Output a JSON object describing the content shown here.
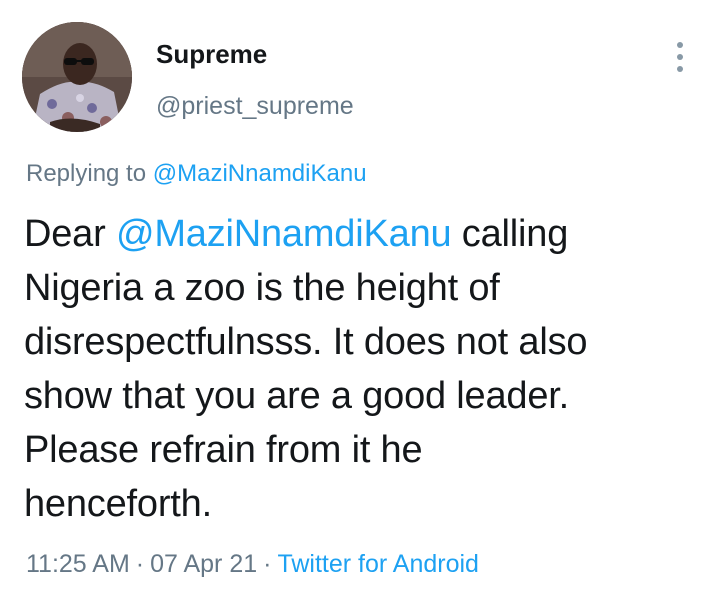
{
  "user": {
    "display_name": "Supreme",
    "handle": "@priest_supreme"
  },
  "header": {
    "more_icon": "vertical-ellipsis-icon"
  },
  "reply": {
    "prefix": "Replying to ",
    "to": "@MaziNnamdiKanu"
  },
  "tweet": {
    "line1_pre": "Dear ",
    "line1_mention": "@MaziNnamdiKanu",
    "line1_post": " calling",
    "line2": "Nigeria a zoo is the height of",
    "line3": "disrespectfulnsss. It does not also",
    "line4": "show that you are a good leader.",
    "line5": "Please refrain from it he",
    "line6": "henceforth."
  },
  "meta": {
    "time": "11:25 AM",
    "separator": "·",
    "date": "07 Apr 21",
    "source": "Twitter for Android"
  },
  "colors": {
    "text": "#14171a",
    "secondary": "#657786",
    "link": "#1da1f2",
    "icon": "#8899a6"
  }
}
